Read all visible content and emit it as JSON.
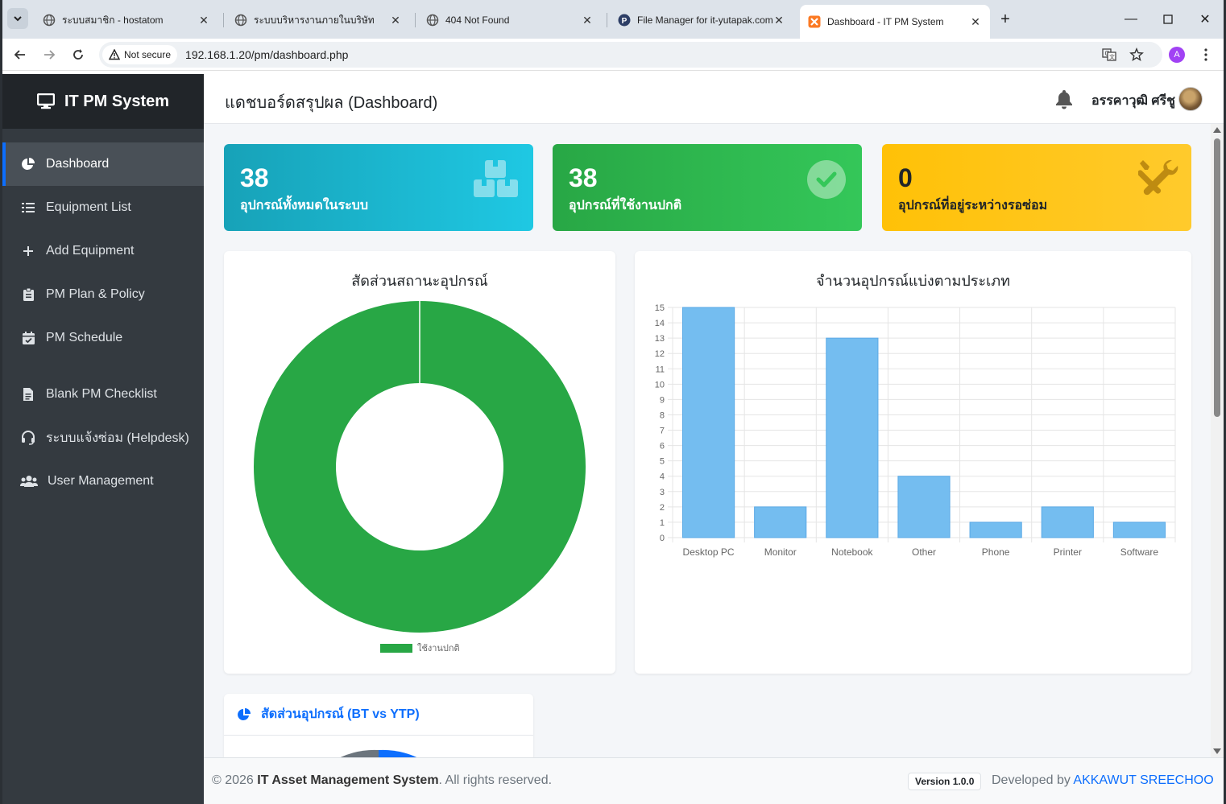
{
  "browser": {
    "tabs": [
      {
        "title": "ระบบสมาชิก - hostatom",
        "icon": "globe-icon"
      },
      {
        "title": "ระบบบริหารงานภายในบริษัท",
        "icon": "globe-icon"
      },
      {
        "title": "404 Not Found",
        "icon": "globe-icon"
      },
      {
        "title": "File Manager for it-yutapak.com",
        "icon": "p-logo-icon"
      },
      {
        "title": "Dashboard - IT PM System",
        "icon": "xampp-icon",
        "active": true
      }
    ],
    "security_label": "Not secure",
    "url": "192.168.1.20/pm/dashboard.php",
    "profile_initial": "A"
  },
  "sidebar": {
    "brand": "IT PM System",
    "items": [
      {
        "label": "Dashboard",
        "icon": "pie-chart-icon",
        "active": true
      },
      {
        "label": "Equipment List",
        "icon": "list-icon"
      },
      {
        "label": "Add Equipment",
        "icon": "plus-icon"
      },
      {
        "label": "PM Plan & Policy",
        "icon": "clipboard-icon"
      },
      {
        "label": "PM Schedule",
        "icon": "calendar-check-icon"
      },
      {
        "label": "Blank PM Checklist",
        "icon": "file-icon"
      },
      {
        "label": "ระบบแจ้งซ่อม (Helpdesk)",
        "icon": "headset-icon"
      },
      {
        "label": "User Management",
        "icon": "users-icon"
      }
    ]
  },
  "header": {
    "title": "แดชบอร์ดสรุปผล (Dashboard)",
    "user_name": "อรรคาวุฒิ ศรีชู"
  },
  "stats": [
    {
      "value": "38",
      "label": "อุปกรณ์ทั้งหมดในระบบ",
      "color": "#17a2b8",
      "icon": "boxes-icon"
    },
    {
      "value": "38",
      "label": "อุปกรณ์ที่ใช้งานปกติ",
      "color": "#28a745",
      "icon": "check-circle-icon"
    },
    {
      "value": "0",
      "label": "อุปกรณ์ที่อยู่ระหว่างรอซ่อม",
      "color": "#ffc107",
      "icon": "tools-icon"
    }
  ],
  "chart_data": [
    {
      "type": "pie",
      "variant": "doughnut",
      "title": "สัดส่วนสถานะอุปกรณ์",
      "labels": [
        "ใช้งานปกติ"
      ],
      "values": [
        38
      ],
      "colors": [
        "#28a745"
      ],
      "legend": "bottom"
    },
    {
      "type": "bar",
      "title": "จำนวนอุปกรณ์แบ่งตามประเภท",
      "categories": [
        "Desktop PC",
        "Monitor",
        "Notebook",
        "Other",
        "Phone",
        "Printer",
        "Software"
      ],
      "values": [
        15,
        2,
        13,
        4,
        1,
        2,
        1
      ],
      "ylim": [
        0,
        15
      ],
      "yticks": [
        "0",
        "1",
        "2",
        "3",
        "4",
        "5",
        "6",
        "7",
        "8",
        "9",
        "10",
        "11",
        "12",
        "13",
        "14",
        "15"
      ],
      "grid": true,
      "color": "#74bdf0"
    }
  ],
  "bt_card": {
    "title": "สัดส่วนอุปกรณ์ (BT vs YTP)",
    "icon": "pie-chart-icon"
  },
  "footer": {
    "copyright": "© 2026",
    "system_name": "IT Asset Management System",
    "rights": ". All rights reserved.",
    "version": "Version 1.0.0",
    "developed_by": "Developed by",
    "developer": "AKKAWUT SREECHOO"
  }
}
